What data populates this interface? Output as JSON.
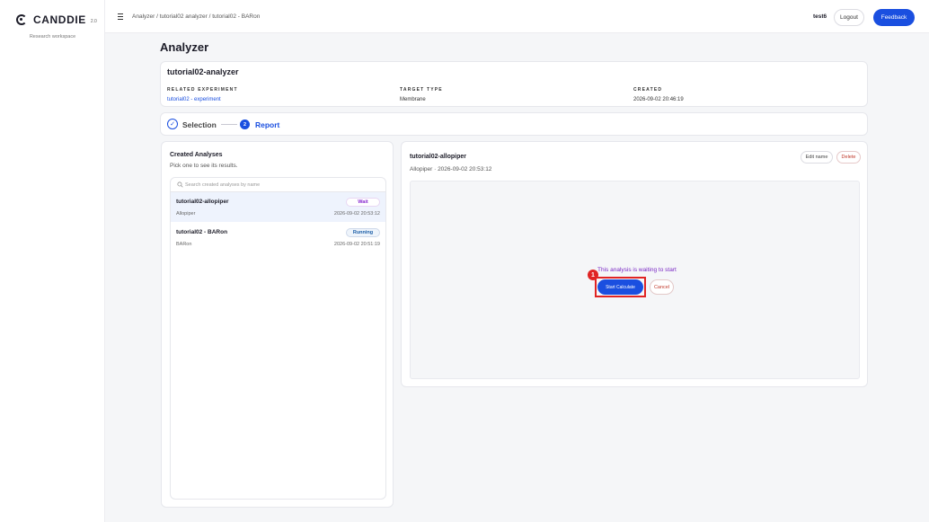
{
  "brand": {
    "name": "CANDDIE",
    "version": "2.0",
    "workspace": "Research workspace"
  },
  "topbar": {
    "breadcrumb": "Analyzer / tutorial02 analyzer / tutorial02 - BARon",
    "user": "test6",
    "logout_label": "Logout",
    "feedback_label": "Feedback"
  },
  "page": {
    "title": "Analyzer"
  },
  "analyzer": {
    "name": "tutorial02-analyzer",
    "related_experiment_label": "RELATED EXPERIMENT",
    "related_experiment_value": "tutorial02 - experiment",
    "target_type_label": "TARGET TYPE",
    "target_type_value": "Membrane",
    "created_label": "CREATED",
    "created_value": "2026-09-02 20:46:19"
  },
  "steps": {
    "step1_label": "Selection",
    "step2_number": "2",
    "step2_label": "Report"
  },
  "created_analyses": {
    "title": "Created Analyses",
    "subtitle": "Pick one to see its results.",
    "search_placeholder": "Search created analyses by name",
    "items": [
      {
        "name": "tutorial02-allopiper",
        "type": "Allopiper",
        "date": "2026-09-02 20:53:12",
        "status": "Wait"
      },
      {
        "name": "tutorial02 - BARon",
        "type": "BARon",
        "date": "2026-09-02 20:51:19",
        "status": "Running"
      }
    ]
  },
  "detail": {
    "title": "tutorial02-allopiper",
    "subtitle": "Allopiper · 2026-09-02 20:53:12",
    "edit_label": "Edit name",
    "delete_label": "Delete",
    "waiting_message": "This analysis is waiting to start",
    "start_label": "Start Calculate",
    "cancel_label": "Cancel",
    "marker_number": "1"
  },
  "colors": {
    "accent": "#1a4fe0",
    "wait": "#8a2bd0",
    "running": "#1d5fa8",
    "danger": "#e02424"
  }
}
